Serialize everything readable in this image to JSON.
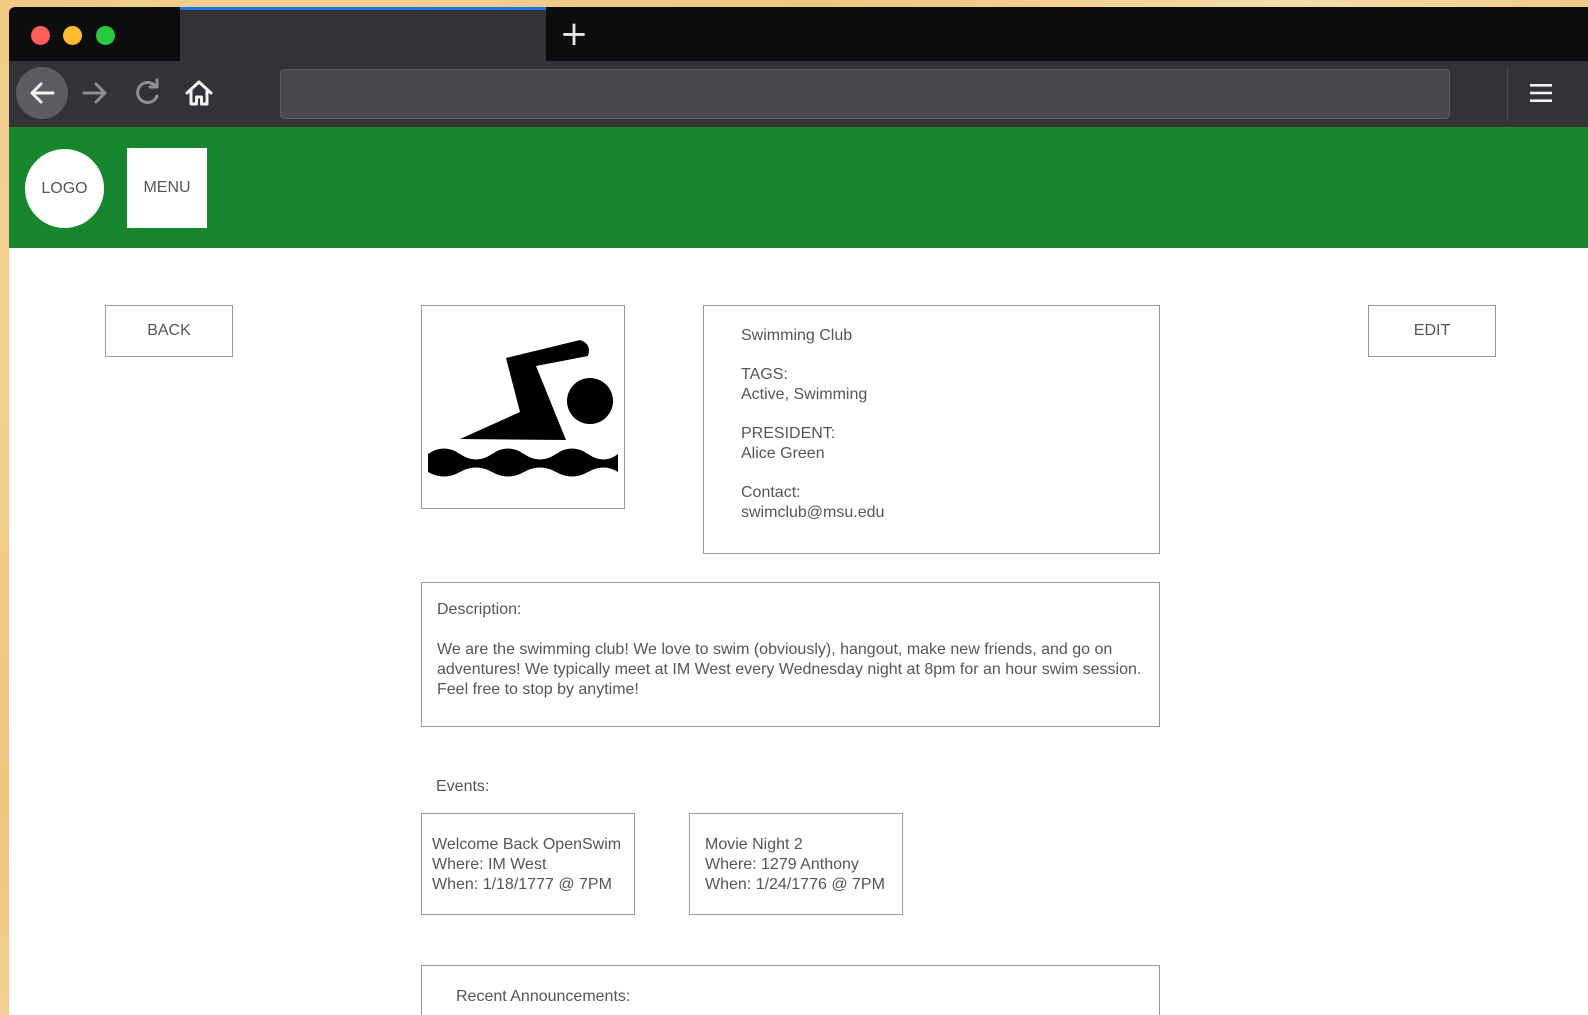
{
  "browser": {
    "new_tab_label": "+",
    "menu_icon": "hamburger-icon",
    "nav_icons": [
      "arrow-left-icon",
      "arrow-right-icon",
      "reload-icon",
      "home-icon"
    ],
    "url": ""
  },
  "header": {
    "logo_label": "LOGO",
    "menu_label": "MENU",
    "color": "#18862e"
  },
  "actions": {
    "back_label": "BACK",
    "edit_label": "EDIT"
  },
  "club": {
    "image_icon": "swimmer-icon",
    "name": "Swimming Club",
    "tags_label": "TAGS:",
    "tags": "Active, Swimming",
    "president_label": "PRESIDENT:",
    "president": "Alice Green",
    "contact_label": "Contact:",
    "contact": "swimclub@msu.edu"
  },
  "description": {
    "label": "Description:",
    "text": "We are the swimming club! We love to swim (obviously), hangout, make new friends, and go on adventures! We typically meet at IM West every Wednesday night at 8pm for an hour swim session. Feel free to stop by anytime!"
  },
  "events": {
    "label": "Events:",
    "items": [
      {
        "title": "Welcome Back OpenSwim",
        "where": "Where: IM West",
        "when": "When: 1/18/1777 @ 7PM"
      },
      {
        "title": "Movie Night 2",
        "where": "Where: 1279 Anthony",
        "when": "When: 1/24/1776 @ 7PM"
      }
    ]
  },
  "announcements": {
    "label": "Recent Announcements:"
  }
}
